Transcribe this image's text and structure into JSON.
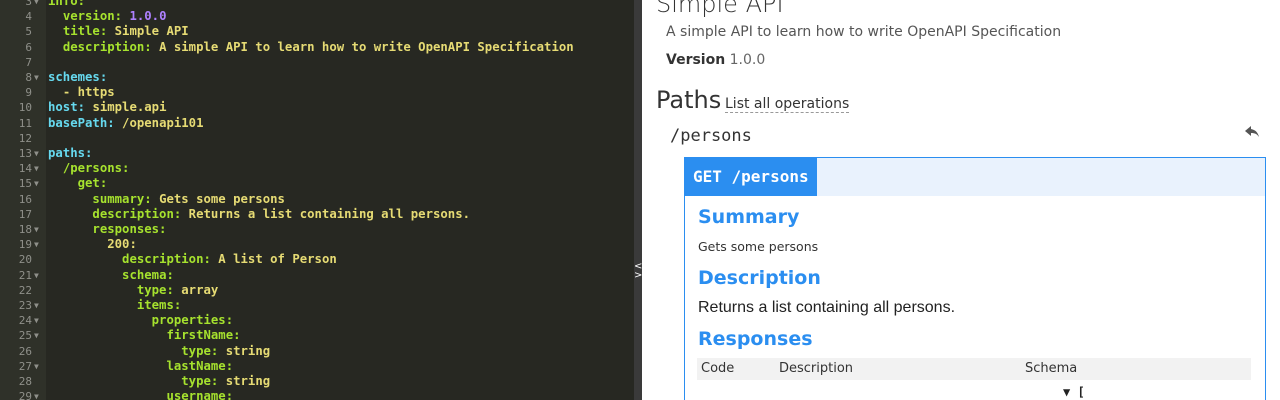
{
  "editor": {
    "lines": [
      {
        "n": "3",
        "fold": true,
        "parts": [
          [
            "k",
            "info:"
          ]
        ]
      },
      {
        "n": "4",
        "fold": false,
        "parts": [
          [
            "t",
            "  "
          ],
          [
            "k",
            "version:"
          ],
          [
            "t",
            " "
          ],
          [
            "num",
            "1.0.0"
          ]
        ]
      },
      {
        "n": "5",
        "fold": false,
        "parts": [
          [
            "t",
            "  "
          ],
          [
            "k",
            "title:"
          ],
          [
            "t",
            " "
          ],
          [
            "v",
            "Simple API"
          ]
        ]
      },
      {
        "n": "6",
        "fold": false,
        "parts": [
          [
            "t",
            "  "
          ],
          [
            "k",
            "description:"
          ],
          [
            "t",
            " "
          ],
          [
            "v",
            "A simple API to learn how to write OpenAPI Specification"
          ]
        ]
      },
      {
        "n": "7",
        "fold": false,
        "parts": []
      },
      {
        "n": "8",
        "fold": true,
        "parts": [
          [
            "k2",
            "schemes:"
          ]
        ]
      },
      {
        "n": "9",
        "fold": false,
        "parts": [
          [
            "t",
            "  "
          ],
          [
            "v",
            "- https"
          ]
        ]
      },
      {
        "n": "10",
        "fold": false,
        "parts": [
          [
            "k2",
            "host:"
          ],
          [
            "t",
            " "
          ],
          [
            "v",
            "simple.api"
          ]
        ]
      },
      {
        "n": "11",
        "fold": false,
        "parts": [
          [
            "k2",
            "basePath:"
          ],
          [
            "t",
            " "
          ],
          [
            "v",
            "/openapi101"
          ]
        ]
      },
      {
        "n": "12",
        "fold": false,
        "parts": []
      },
      {
        "n": "13",
        "fold": true,
        "parts": [
          [
            "k2",
            "paths:"
          ]
        ]
      },
      {
        "n": "14",
        "fold": true,
        "parts": [
          [
            "t",
            "  "
          ],
          [
            "k",
            "/persons:"
          ]
        ]
      },
      {
        "n": "15",
        "fold": true,
        "parts": [
          [
            "t",
            "    "
          ],
          [
            "k",
            "get:"
          ]
        ]
      },
      {
        "n": "16",
        "fold": false,
        "parts": [
          [
            "t",
            "      "
          ],
          [
            "k",
            "summary:"
          ],
          [
            "t",
            " "
          ],
          [
            "v",
            "Gets some persons"
          ]
        ]
      },
      {
        "n": "17",
        "fold": false,
        "parts": [
          [
            "t",
            "      "
          ],
          [
            "k",
            "description:"
          ],
          [
            "t",
            " "
          ],
          [
            "v",
            "Returns a list containing all persons."
          ]
        ]
      },
      {
        "n": "18",
        "fold": true,
        "parts": [
          [
            "t",
            "      "
          ],
          [
            "k",
            "responses:"
          ]
        ]
      },
      {
        "n": "19",
        "fold": true,
        "parts": [
          [
            "t",
            "        "
          ],
          [
            "v",
            "200:"
          ]
        ]
      },
      {
        "n": "20",
        "fold": false,
        "parts": [
          [
            "t",
            "          "
          ],
          [
            "k",
            "description:"
          ],
          [
            "t",
            " "
          ],
          [
            "v",
            "A list of Person"
          ]
        ]
      },
      {
        "n": "21",
        "fold": true,
        "parts": [
          [
            "t",
            "          "
          ],
          [
            "k",
            "schema:"
          ]
        ]
      },
      {
        "n": "22",
        "fold": false,
        "parts": [
          [
            "t",
            "            "
          ],
          [
            "k",
            "type:"
          ],
          [
            "t",
            " "
          ],
          [
            "v",
            "array"
          ]
        ]
      },
      {
        "n": "23",
        "fold": true,
        "parts": [
          [
            "t",
            "            "
          ],
          [
            "k",
            "items:"
          ]
        ]
      },
      {
        "n": "24",
        "fold": true,
        "parts": [
          [
            "t",
            "              "
          ],
          [
            "k",
            "properties:"
          ]
        ]
      },
      {
        "n": "25",
        "fold": true,
        "parts": [
          [
            "t",
            "                "
          ],
          [
            "k",
            "firstName:"
          ]
        ]
      },
      {
        "n": "26",
        "fold": false,
        "parts": [
          [
            "t",
            "                  "
          ],
          [
            "k",
            "type:"
          ],
          [
            "t",
            " "
          ],
          [
            "v",
            "string"
          ]
        ]
      },
      {
        "n": "27",
        "fold": true,
        "parts": [
          [
            "t",
            "                "
          ],
          [
            "k",
            "lastName:"
          ]
        ]
      },
      {
        "n": "28",
        "fold": false,
        "parts": [
          [
            "t",
            "                  "
          ],
          [
            "k",
            "type:"
          ],
          [
            "t",
            " "
          ],
          [
            "v",
            "string"
          ]
        ]
      },
      {
        "n": "29",
        "fold": true,
        "parts": [
          [
            "t",
            "                "
          ],
          [
            "k",
            "username:"
          ]
        ]
      }
    ]
  },
  "splitter": {
    "arrow_left": "<",
    "arrow_right": ">"
  },
  "preview": {
    "title": "Simple API",
    "description": "A simple API to learn how to write OpenAPI Specification",
    "version_label": "Version",
    "version_value": "1.0.0",
    "paths_title": "Paths",
    "list_ops_link": "List all operations",
    "path_name": "/persons",
    "back_icon": "reply-arrow-icon",
    "operation": {
      "tag": "GET /persons",
      "summary_title": "Summary",
      "summary_text": "Gets some persons",
      "description_title": "Description",
      "description_text": "Returns a list containing all persons.",
      "responses_title": "Responses",
      "col_code": "Code",
      "col_description": "Description",
      "col_schema": "Schema",
      "schema_toggle": "▼ ["
    }
  },
  "colors": {
    "editor_bg": "#272822",
    "accent": "#2b8ef0",
    "yaml_key": "#a6e22e",
    "yaml_string": "#e6db74",
    "yaml_number": "#ae81ff"
  }
}
